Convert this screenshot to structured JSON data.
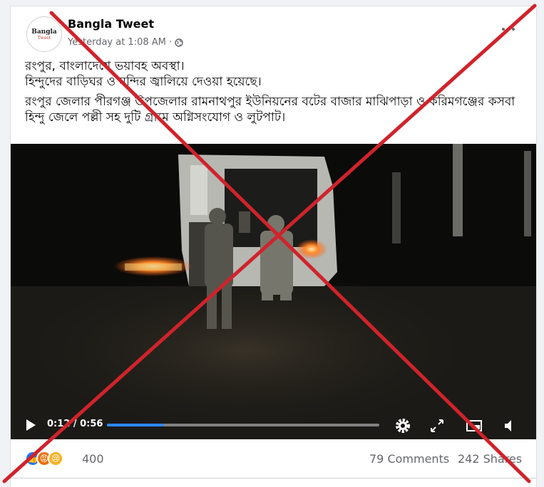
{
  "post": {
    "page_name": "Bangla Tweet",
    "timestamp": "Yesterday at 1:08 AM",
    "separator": "·",
    "avatar_text": "Bangla",
    "avatar_subtext": "Tweet",
    "paragraphs": [
      "রংপুর, বাংলাদেশে ভয়াবহ অবস্থা।",
      "হিন্দুদের বাড়িঘর ও মন্দির জ্বালিয়ে দেওয়া হয়েছে।",
      "রংপুর জেলার পীরগঞ্জ উপজেলার রামনাথপুর ইউনিয়নের বটের বাজার মাঝিপাড়া ও করিমগঞ্জের কসবা হিন্দু জেলে পল্লী সহ দুটি গ্রামে অগ্নিসংযোগ ও লুটপাট।"
    ]
  },
  "video": {
    "current_time": "0:12",
    "duration": "0:56",
    "time_display": "0:12 / 0:56",
    "progress": 0.21
  },
  "footer": {
    "reaction_count": "400",
    "comments": "79 Comments",
    "shares": "242 Shares",
    "reactions": [
      "like-icon",
      "angry-icon",
      "sad-icon"
    ]
  },
  "colors": {
    "accent": "#2d88ff",
    "cross": "#d0232b"
  }
}
